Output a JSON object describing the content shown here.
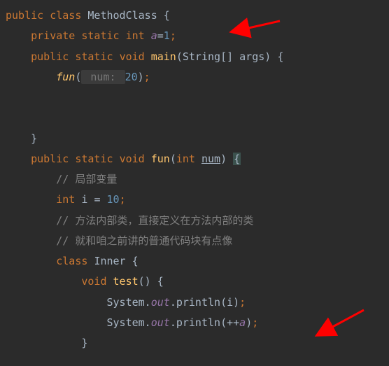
{
  "code": {
    "l1": {
      "kw1": "public ",
      "kw2": "class ",
      "cls": "MethodClass ",
      "brace": "{"
    },
    "l2": {
      "kw1": "private ",
      "kw2": "static ",
      "kw3": "int ",
      "fld": "a",
      "eq": "=",
      "num": "1",
      "semi": ";"
    },
    "l3": {
      "kw1": "public ",
      "kw2": "static ",
      "kw3": "void ",
      "mth": "main",
      "p1": "(",
      "typ": "String",
      "arr": "[] args",
      "p2": ") {"
    },
    "l4": {
      "mth": "fun",
      "p1": "(",
      "hint": " num: ",
      "num": "20",
      "p2": ")",
      "semi": ";"
    },
    "l5": {
      "brace": "}"
    },
    "l6": {
      "kw1": "public ",
      "kw2": "static ",
      "kw3": "void ",
      "mth": "fun",
      "p1": "(",
      "typ": "int ",
      "param": "num",
      "p2": ") ",
      "brace": "{"
    },
    "l7": {
      "c": "// 局部变量"
    },
    "l8": {
      "kw1": "int ",
      "var": "i ",
      "eq": "= ",
      "num": "10",
      "semi": ";"
    },
    "l9": {
      "c": "// 方法内部类，直接定义在方法内部的类"
    },
    "l10": {
      "c": "// 就和咱之前讲的普通代码块有点像"
    },
    "l11": {
      "kw1": "class ",
      "cls": "Inner ",
      "brace": "{"
    },
    "l12": {
      "kw1": "void ",
      "mth": "test",
      "p1": "() {"
    },
    "l13": {
      "sys": "System.",
      "out": "out",
      "dot": ".",
      "mth": "println",
      "p1": "(",
      "var": "i",
      "p2": ")",
      "semi": ";"
    },
    "l14": {
      "sys": "System.",
      "out": "out",
      "dot": ".",
      "mth": "println",
      "p1": "(++",
      "fld": "a",
      "p2": ")",
      "semi": ";"
    },
    "l15": {
      "brace": "}"
    }
  }
}
